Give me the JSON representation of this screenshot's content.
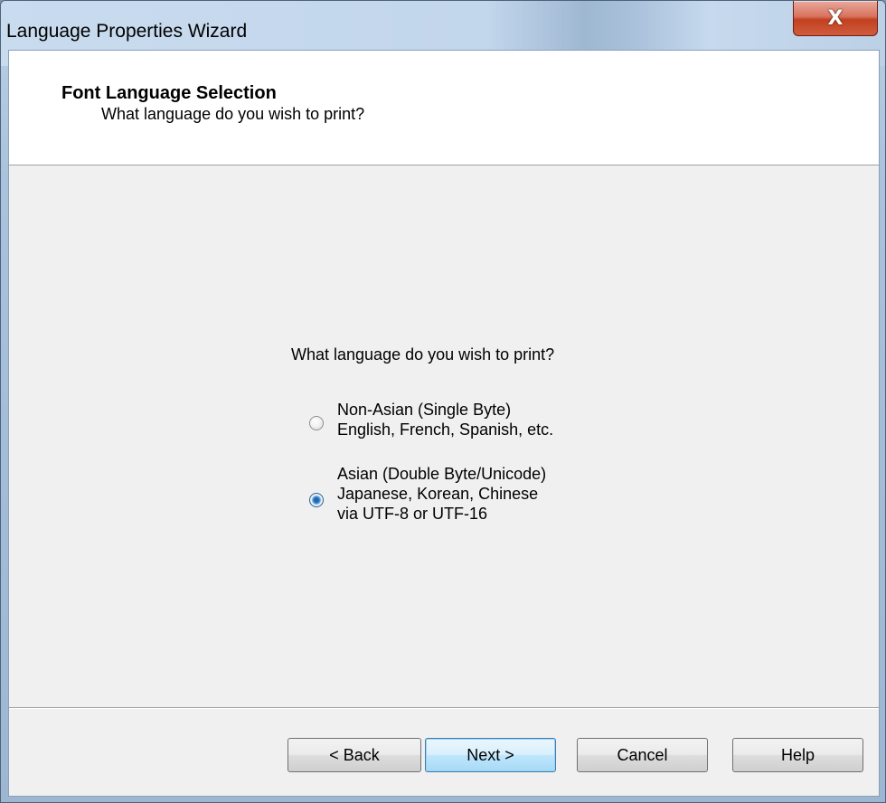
{
  "window": {
    "title": "Language Properties Wizard",
    "close_label": "X"
  },
  "header": {
    "title": "Font Language Selection",
    "subtitle": "What language do you wish to print?"
  },
  "main": {
    "question": "What language do you wish to print?",
    "options": [
      {
        "lines": [
          "Non-Asian (Single Byte)",
          "English, French, Spanish, etc."
        ],
        "selected": false
      },
      {
        "lines": [
          "Asian (Double Byte/Unicode)",
          "Japanese, Korean, Chinese",
          "via UTF-8 or UTF-16"
        ],
        "selected": true
      }
    ]
  },
  "buttons": {
    "back": "< Back",
    "next": "Next >",
    "cancel": "Cancel",
    "help": "Help"
  },
  "colors": {
    "selection_blue": "#2a75c0",
    "default_button_border": "#3c7fb1"
  }
}
